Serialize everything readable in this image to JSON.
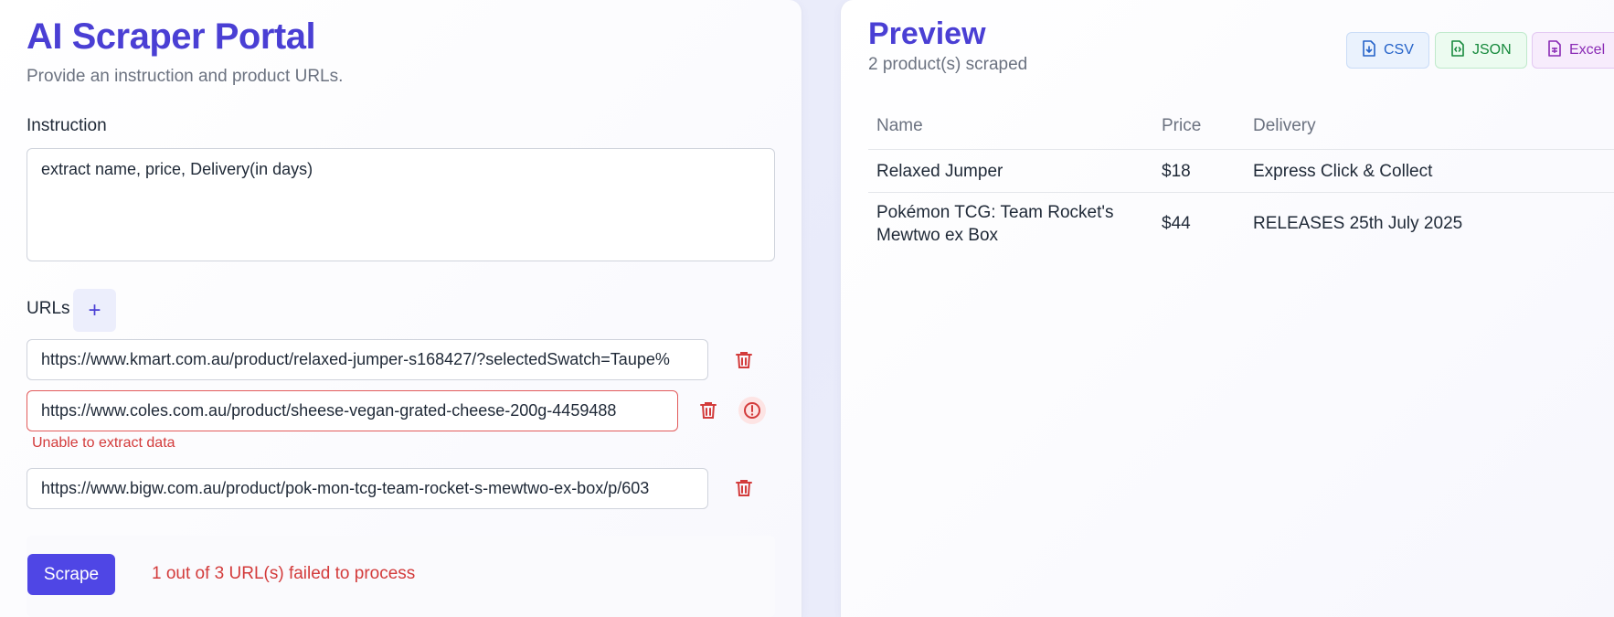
{
  "app": {
    "title": "AI Scraper Portal",
    "subtitle": "Provide an instruction and product URLs."
  },
  "instruction": {
    "label": "Instruction",
    "value": "extract name, price, Delivery(in days)"
  },
  "urls": {
    "label": "URLs",
    "add_icon": "+",
    "items": [
      {
        "value": "https://www.kmart.com.au/product/relaxed-jumper-s168427/?selectedSwatch=Taupe%",
        "error": ""
      },
      {
        "value": "https://www.coles.com.au/product/sheese-vegan-grated-cheese-200g-4459488",
        "error": "Unable to extract data"
      },
      {
        "value": "https://www.bigw.com.au/product/pok-mon-tcg-team-rocket-s-mewtwo-ex-box/p/603",
        "error": ""
      }
    ]
  },
  "actions": {
    "scrape_label": "Scrape",
    "status_message": "1 out of 3 URL(s) failed to process"
  },
  "preview": {
    "title": "Preview",
    "count_text": "2 product(s) scraped",
    "exports": [
      {
        "label": "CSV",
        "icon": "file-download-icon",
        "color": "#2563c9"
      },
      {
        "label": "JSON",
        "icon": "file-code-icon",
        "color": "#178a3d"
      },
      {
        "label": "Excel",
        "icon": "file-spreadsheet-icon",
        "color": "#8a2bb5"
      }
    ],
    "columns": [
      "Name",
      "Price",
      "Delivery"
    ],
    "rows": [
      {
        "name": "Relaxed Jumper",
        "price": "$18",
        "delivery": "Express Click & Collect"
      },
      {
        "name": "Pokémon TCG: Team Rocket's Mewtwo ex Box",
        "price": "$44",
        "delivery": "RELEASES 25th July 2025"
      }
    ]
  },
  "colors": {
    "accent": "#4a3fd4",
    "button": "#4f46e5",
    "error": "#d33b3b"
  }
}
